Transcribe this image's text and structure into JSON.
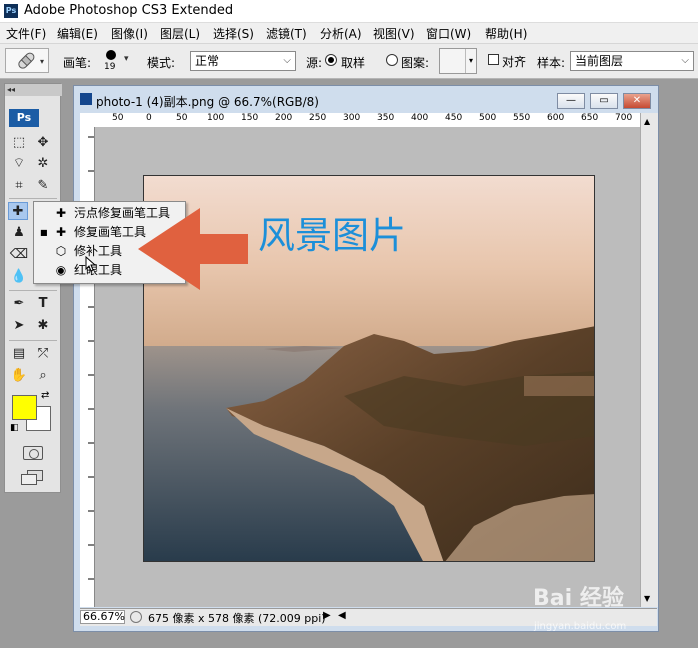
{
  "app": {
    "title": "Adobe Photoshop CS3 Extended",
    "logo_text": "Ps"
  },
  "menu": [
    "文件(F)",
    "编辑(E)",
    "图像(I)",
    "图层(L)",
    "选择(S)",
    "滤镜(T)",
    "分析(A)",
    "视图(V)",
    "窗口(W)",
    "帮助(H)"
  ],
  "options": {
    "brush_label": "画笔:",
    "brush_size": "19",
    "mode_label": "模式:",
    "mode_value": "正常",
    "source_label": "源:",
    "source_sample": "取样",
    "source_pattern": "图案:",
    "aligned_label": "对齐",
    "sample_label": "样本:",
    "sample_value": "当前图层"
  },
  "toolbox": {
    "logo": "Ps"
  },
  "document": {
    "title": "photo-1 (4)副本.png @ 66.7%(RGB/8)",
    "ruler_ticks": [
      "50",
      "0",
      "50",
      "100",
      "150",
      "200",
      "250",
      "300",
      "350",
      "400",
      "450",
      "500",
      "550",
      "600",
      "650",
      "700"
    ],
    "zoom": "66.67%",
    "status": "675 像素 x 578 像素 (72.009 ppi)"
  },
  "flyout": {
    "items": [
      {
        "label": "污点修复画笔工具",
        "key": "J",
        "icon": "spot-healing-icon"
      },
      {
        "label": "修复画笔工具",
        "key": "J",
        "icon": "healing-brush-icon"
      },
      {
        "label": "修补工具",
        "key": "J",
        "icon": "patch-icon"
      },
      {
        "label": "红眼工具",
        "key": "J",
        "icon": "red-eye-icon"
      }
    ]
  },
  "annotation": "风景图片",
  "watermark": {
    "brand": "Bai 经验",
    "url": "jingyan.baidu.com"
  },
  "colors": {
    "foreground": "#ffff00",
    "background": "#ffffff",
    "arrow": "#e0613f",
    "annotation": "#1c8fd9"
  }
}
